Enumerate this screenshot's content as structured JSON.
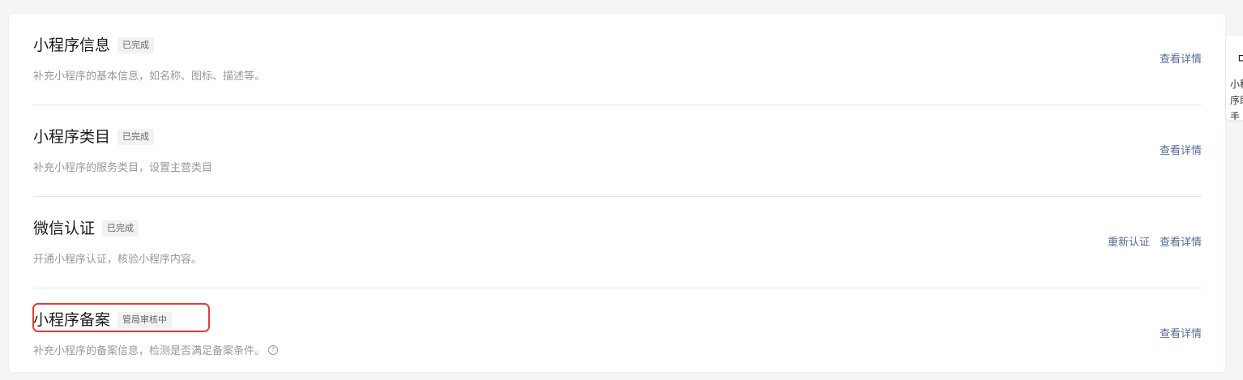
{
  "items": [
    {
      "title": "小程序信息",
      "badge": "已完成",
      "desc": "补充小程序的基本信息，如名称、图标、描述等。",
      "actions": [
        "查看详情"
      ]
    },
    {
      "title": "小程序类目",
      "badge": "已完成",
      "desc": "补充小程序的服务类目，设置主营类目",
      "actions": [
        "查看详情"
      ]
    },
    {
      "title": "微信认证",
      "badge": "已完成",
      "desc": "开通小程序认证，核验小程序内容。",
      "actions": [
        "重新认证",
        "查看详情"
      ]
    },
    {
      "title": "小程序备案",
      "badge": "管局审核中",
      "desc": "补充小程序的备案信息，检测是否满足备案条件。",
      "actions": [
        "查看详情"
      ]
    }
  ],
  "side_panel": {
    "icon": "assistant-icon",
    "text": "小程序助手"
  },
  "colors": {
    "link": "#576b95",
    "highlight": "#e23a3a"
  }
}
